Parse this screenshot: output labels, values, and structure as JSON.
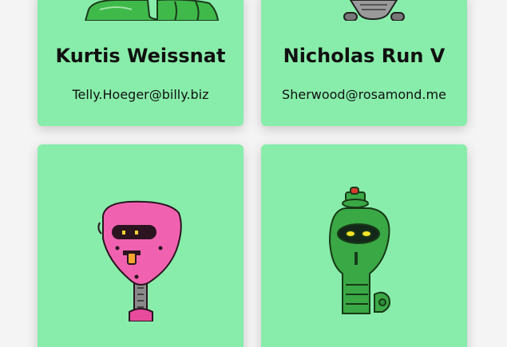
{
  "cards": [
    {
      "name": "Kurtis Weissnat",
      "email": "Telly.Hoeger@billy.biz",
      "robot": "green-robot-avatar",
      "color": "#3fb94a"
    },
    {
      "name": "Nicholas Run V",
      "email": "Sherwood@rosamond.me",
      "robot": "gray-robot-avatar",
      "color": "#8a8a8a"
    },
    {
      "name": "",
      "email": "",
      "robot": "pink-robot-avatar",
      "color": "#f062b0"
    },
    {
      "name": "",
      "email": "",
      "robot": "green-capsule-robot-avatar",
      "color": "#3aa845"
    }
  ],
  "theme": {
    "card_bg": "#88edaa",
    "page_bg": "#f4f4f4"
  }
}
